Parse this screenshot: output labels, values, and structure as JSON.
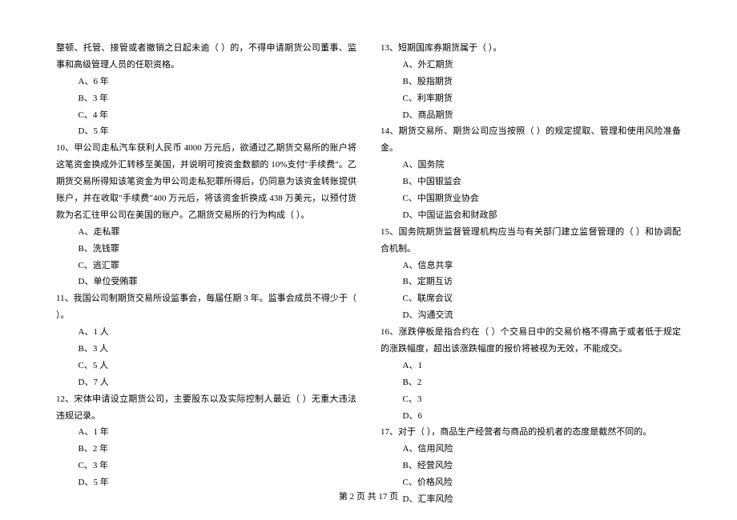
{
  "left": {
    "intro": "整顿、托管、接管或者撤销之日起未逾（     ）的，不得申请期货公司董事、监事和高级管理人员的任职资格。",
    "introOpts": {
      "a": "A、6 年",
      "b": "B、3 年",
      "c": "C、4 年",
      "d": "D、5 年"
    },
    "q10": "10、甲公司走私汽车获利人民币 4000 万元后，欲通过乙期货交易所的账户将这笔资金换成外汇转移至美国，并说明可按资金数额的 10%支付\"手续费\"。乙期货交易所得知该笔资金为甲公司走私犯罪所得后，仍同意为该资金转账提供账户，并在收取\"手续费\"400 万元后，将该资金折换成 438 万美元，以预付货款为名汇往甲公司在美国的账户。乙期货交易所的行为构成（     ）。",
    "q10Opts": {
      "a": "A、走私罪",
      "b": "B、洗钱罪",
      "c": "C、逃汇罪",
      "d": "D、单位受贿罪"
    },
    "q11": "11、我国公司制期货交易所设监事会，每届任期 3 年。监事会成员不得少于（     ）。",
    "q11Opts": {
      "a": "A、1 人",
      "b": "B、3 人",
      "c": "C、5 人",
      "d": "D、7 人"
    },
    "q12": "12、宋体申请设立期货公司，主要股东以及实际控制人最近（     ）无重大违法违规记录。",
    "q12Opts": {
      "a": "A、1 年",
      "b": "B、2 年",
      "c": "C、3 年",
      "d": "D、5 年"
    }
  },
  "right": {
    "q13": "13、短期国库券期货属于（     ）。",
    "q13Opts": {
      "a": "A、外汇期货",
      "b": "B、股指期货",
      "c": "C、利率期货",
      "d": "D、商品期货"
    },
    "q14": "14、期货交易所、期货公司应当按照（     ）的规定提取、管理和使用风险准备金。",
    "q14Opts": {
      "a": "A、国务院",
      "b": "B、中国银监会",
      "c": "C、中国期货业协会",
      "d": "D、中国证监会和财政部"
    },
    "q15": "15、国务院期货监督管理机构应当与有关部门建立监督管理的（     ）和协调配合机制。",
    "q15Opts": {
      "a": "A、信息共享",
      "b": "B、定期互访",
      "c": "C、联席会议",
      "d": "D、沟通交流"
    },
    "q16": "16、涨跌停板是指合约在（     ）个交易日中的交易价格不得高于或者低于规定的涨跌幅度，超出该涨跌幅度的报价将被视为无效，不能成交。",
    "q16Opts": {
      "a": "A、1",
      "b": "B、2",
      "c": "C、3",
      "d": "D、6"
    },
    "q17": "17、对于（     ），商品生产经营者与商品的投机者的态度是截然不同的。",
    "q17Opts": {
      "a": "A、信用风险",
      "b": "B、经营风险",
      "c": "C、价格风险",
      "d": "D、汇率风险"
    }
  },
  "footer": "第 2 页 共 17 页"
}
